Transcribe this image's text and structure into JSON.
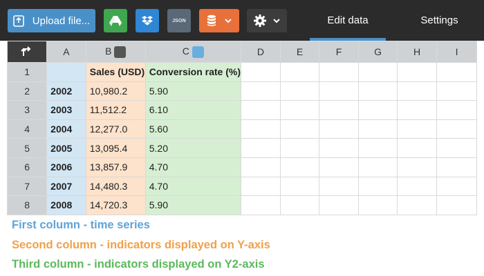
{
  "toolbar": {
    "upload_label": "Upload file...",
    "json_label": "JSON",
    "tabs": [
      {
        "label": "Edit data",
        "active": true
      },
      {
        "label": "Settings",
        "active": false
      }
    ],
    "colors": {
      "background": "#2b2b2b",
      "upload": "#4a90c8",
      "gdrive": "#3fa74f",
      "dropbox": "#2f86d4",
      "json": "#5a6977",
      "database": "#e8703a",
      "gear": "#3c3c3c"
    },
    "icons": [
      "upload-icon",
      "google-drive-icon",
      "dropbox-icon",
      "json-icon",
      "database-icon",
      "chevron-down-icon",
      "gear-icon"
    ]
  },
  "grid": {
    "corner_icon": "swap-axes-icon",
    "columns": [
      "A",
      "B",
      "C",
      "D",
      "E",
      "F",
      "G",
      "H",
      "I"
    ],
    "column_swatches": {
      "B": "#555555",
      "C": "#6aaee0"
    },
    "row_numbers": [
      "1",
      "2",
      "3",
      "4",
      "5",
      "6",
      "7",
      "8"
    ],
    "rows": [
      [
        "",
        "Sales (USD)",
        "Conversion rate (%)",
        "",
        "",
        "",
        "",
        "",
        ""
      ],
      [
        "2002",
        "10,980.2",
        "5.90",
        "",
        "",
        "",
        "",
        "",
        ""
      ],
      [
        "2003",
        "11,512.2",
        "6.10",
        "",
        "",
        "",
        "",
        "",
        ""
      ],
      [
        "2004",
        "12,277.0",
        "5.60",
        "",
        "",
        "",
        "",
        "",
        ""
      ],
      [
        "2005",
        "13,095.4",
        "5.20",
        "",
        "",
        "",
        "",
        "",
        ""
      ],
      [
        "2006",
        "13,857.9",
        "4.70",
        "",
        "",
        "",
        "",
        "",
        ""
      ],
      [
        "2007",
        "14,480.3",
        "4.70",
        "",
        "",
        "",
        "",
        "",
        ""
      ],
      [
        "2008",
        "14,720.3",
        "5.90",
        "",
        "",
        "",
        "",
        "",
        ""
      ]
    ],
    "column_colors": {
      "A": "#d3e6f4",
      "B": "#fde2cc",
      "C": "#d6efd3"
    }
  },
  "captions": {
    "first": {
      "text": "First column - time series",
      "color": "#5fa3d6"
    },
    "second": {
      "text": "Second column - indicators displayed on Y-axis",
      "color": "#f0a04b"
    },
    "third": {
      "text": "Third column - indicators displayed on Y2-axis",
      "color": "#5cb85c"
    }
  }
}
